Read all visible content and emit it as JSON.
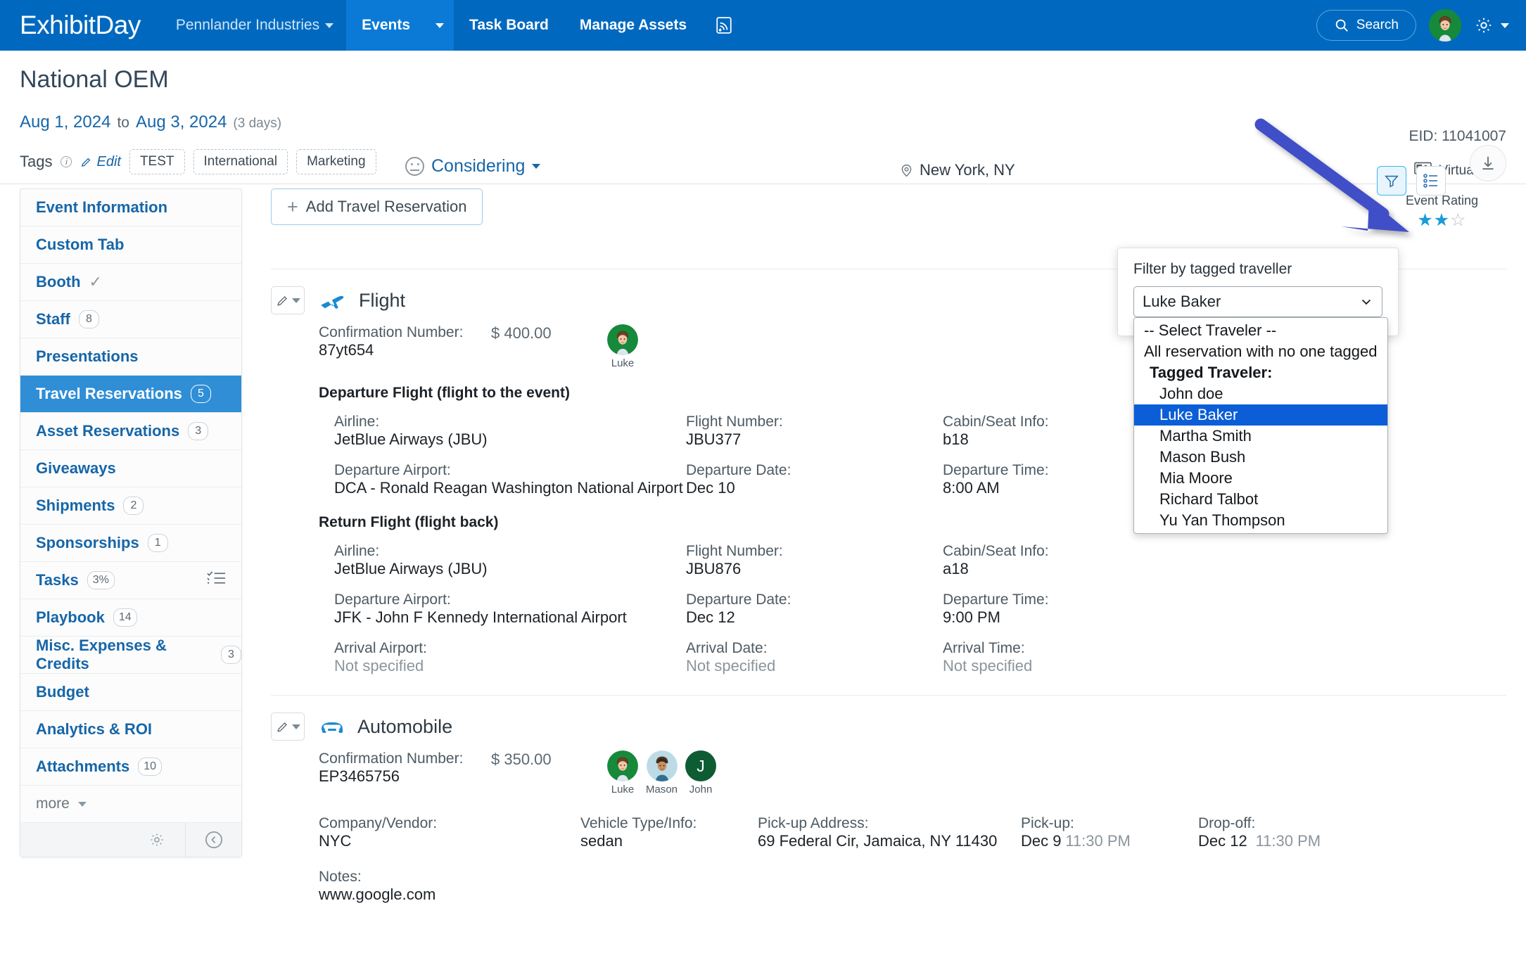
{
  "nav": {
    "brand": "ExhibitDay",
    "org": "Pennlander Industries",
    "items": [
      {
        "label": "Events",
        "active": true
      },
      {
        "label": "Task Board",
        "active": false
      },
      {
        "label": "Manage Assets",
        "active": false
      }
    ],
    "feed_icon": "rss-icon",
    "search_label": "Search",
    "settings_icon": "gear-icon"
  },
  "event": {
    "title": "National OEM",
    "date_start": "Aug 1, 2024",
    "date_to": "to",
    "date_end": "Aug 3, 2024",
    "duration": "(3 days)",
    "status": "Considering",
    "location": "New York, NY",
    "eid": "EID: 11041007",
    "virtual": "Virtual",
    "rating_label": "Event Rating",
    "rating_value": 2,
    "rating_max": 3,
    "tags_label": "Tags",
    "edit_label": "Edit",
    "tags": [
      "TEST",
      "International",
      "Marketing"
    ]
  },
  "sidebar": {
    "items": [
      {
        "label": "Event Information",
        "badge": "",
        "active": false
      },
      {
        "label": "Custom Tab",
        "badge": "",
        "active": false
      },
      {
        "label": "Booth",
        "badge": "",
        "active": false,
        "check": true
      },
      {
        "label": "Staff",
        "badge": "8",
        "active": false
      },
      {
        "label": "Presentations",
        "badge": "",
        "active": false
      },
      {
        "label": "Travel Reservations",
        "badge": "5",
        "active": true
      },
      {
        "label": "Asset Reservations",
        "badge": "3",
        "active": false
      },
      {
        "label": "Giveaways",
        "badge": "",
        "active": false
      },
      {
        "label": "Shipments",
        "badge": "2",
        "active": false
      },
      {
        "label": "Sponsorships",
        "badge": "1",
        "active": false
      },
      {
        "label": "Tasks",
        "badge": "3%",
        "active": false,
        "tasks_icon": true
      },
      {
        "label": "Playbook",
        "badge": "14",
        "active": false
      },
      {
        "label": "Misc. Expenses & Credits",
        "badge": "3",
        "active": false
      },
      {
        "label": "Budget",
        "badge": "",
        "active": false
      },
      {
        "label": "Analytics & ROI",
        "badge": "",
        "active": false
      },
      {
        "label": "Attachments",
        "badge": "10",
        "active": false
      },
      {
        "label": "more",
        "badge": "",
        "active": false,
        "more": true
      }
    ],
    "footer": {
      "settings_icon": "gear-icon",
      "collapse_icon": "collapse-left-icon"
    }
  },
  "toolbar": {
    "add_label": "Add Travel Reservation",
    "filter_icon": "filter-icon",
    "list_icon": "list-view-icon",
    "download_icon": "download-icon"
  },
  "filter_popover": {
    "label": "Filter by tagged traveller",
    "selected": "Luke Baker",
    "options": [
      {
        "label": "-- Select Traveler --",
        "type": "plain"
      },
      {
        "label": "All reservation with no one tagged",
        "type": "plain"
      },
      {
        "label": "Tagged Traveler:",
        "type": "head"
      },
      {
        "label": "John doe",
        "type": "opt"
      },
      {
        "label": "Luke Baker",
        "type": "opt",
        "selected": true
      },
      {
        "label": "Martha Smith",
        "type": "opt"
      },
      {
        "label": "Mason Bush",
        "type": "opt"
      },
      {
        "label": "Mia Moore",
        "type": "opt"
      },
      {
        "label": "Richard Talbot",
        "type": "opt"
      },
      {
        "label": "Yu Yan Thompson",
        "type": "opt"
      }
    ]
  },
  "reservations": [
    {
      "type": "Flight",
      "icon": "airplane-icon",
      "confirmation_label": "Confirmation Number:",
      "confirmation_value": "87yt654",
      "price": "$ 400.00",
      "travelers": [
        {
          "name": "Luke",
          "kind": "photo-green"
        }
      ],
      "segments": [
        {
          "heading": "Departure Flight (flight to the event)",
          "rows": [
            [
              {
                "k": "Airline:",
                "v": "JetBlue Airways (JBU)"
              },
              {
                "k": "Flight Number:",
                "v": "JBU377"
              },
              {
                "k": "Cabin/Seat Info:",
                "v": "b18"
              }
            ],
            [
              {
                "k": "Departure Airport:",
                "v": "DCA - Ronald Reagan Washington National Airport"
              },
              {
                "k": "Departure Date:",
                "v": "Dec 10"
              },
              {
                "k": "Departure Time:",
                "v": "8:00 AM"
              }
            ]
          ]
        },
        {
          "heading": "Return Flight (flight back)",
          "rows": [
            [
              {
                "k": "Airline:",
                "v": "JetBlue Airways (JBU)"
              },
              {
                "k": "Flight Number:",
                "v": "JBU876"
              },
              {
                "k": "Cabin/Seat Info:",
                "v": "a18"
              }
            ],
            [
              {
                "k": "Departure Airport:",
                "v": "JFK - John F Kennedy International Airport"
              },
              {
                "k": "Departure Date:",
                "v": "Dec 12"
              },
              {
                "k": "Departure Time:",
                "v": "9:00 PM"
              }
            ],
            [
              {
                "k": "Arrival Airport:",
                "v": "Not specified",
                "muted": true
              },
              {
                "k": "Arrival Date:",
                "v": "Not specified",
                "muted": true
              },
              {
                "k": "Arrival Time:",
                "v": "Not specified",
                "muted": true
              }
            ]
          ]
        }
      ]
    },
    {
      "type": "Automobile",
      "icon": "car-icon",
      "confirmation_label": "Confirmation Number:",
      "confirmation_value": "EP3465756",
      "price": "$ 350.00",
      "travelers": [
        {
          "name": "Luke",
          "kind": "photo-green"
        },
        {
          "name": "Mason",
          "kind": "photo-blue"
        },
        {
          "name": "John",
          "kind": "initial",
          "initial": "J"
        }
      ],
      "fields": [
        {
          "k": "Company/Vendor:",
          "v": "NYC"
        },
        {
          "k": "Vehicle Type/Info:",
          "v": "sedan"
        },
        {
          "k": "Pick-up Address:",
          "v": "69 Federal Cir, Jamaica, NY 11430"
        },
        {
          "k": "Pick-up:",
          "v": "Dec 9",
          "v2": "11:30 PM"
        },
        {
          "k": "Drop-off:",
          "v": "Dec 12",
          "v2": "11:30 PM"
        }
      ],
      "notes_label": "Notes:",
      "notes_value": "www.google.com"
    }
  ],
  "colors": {
    "nav_blue": "#0069bf",
    "nav_active": "#0b7ad6",
    "link_blue": "#1666a8",
    "sidebar_active": "#2f8ed6",
    "accent_icon": "#1a8ad4",
    "annotation_arrow": "#4150c8",
    "select_highlight": "#0b5ed7"
  }
}
